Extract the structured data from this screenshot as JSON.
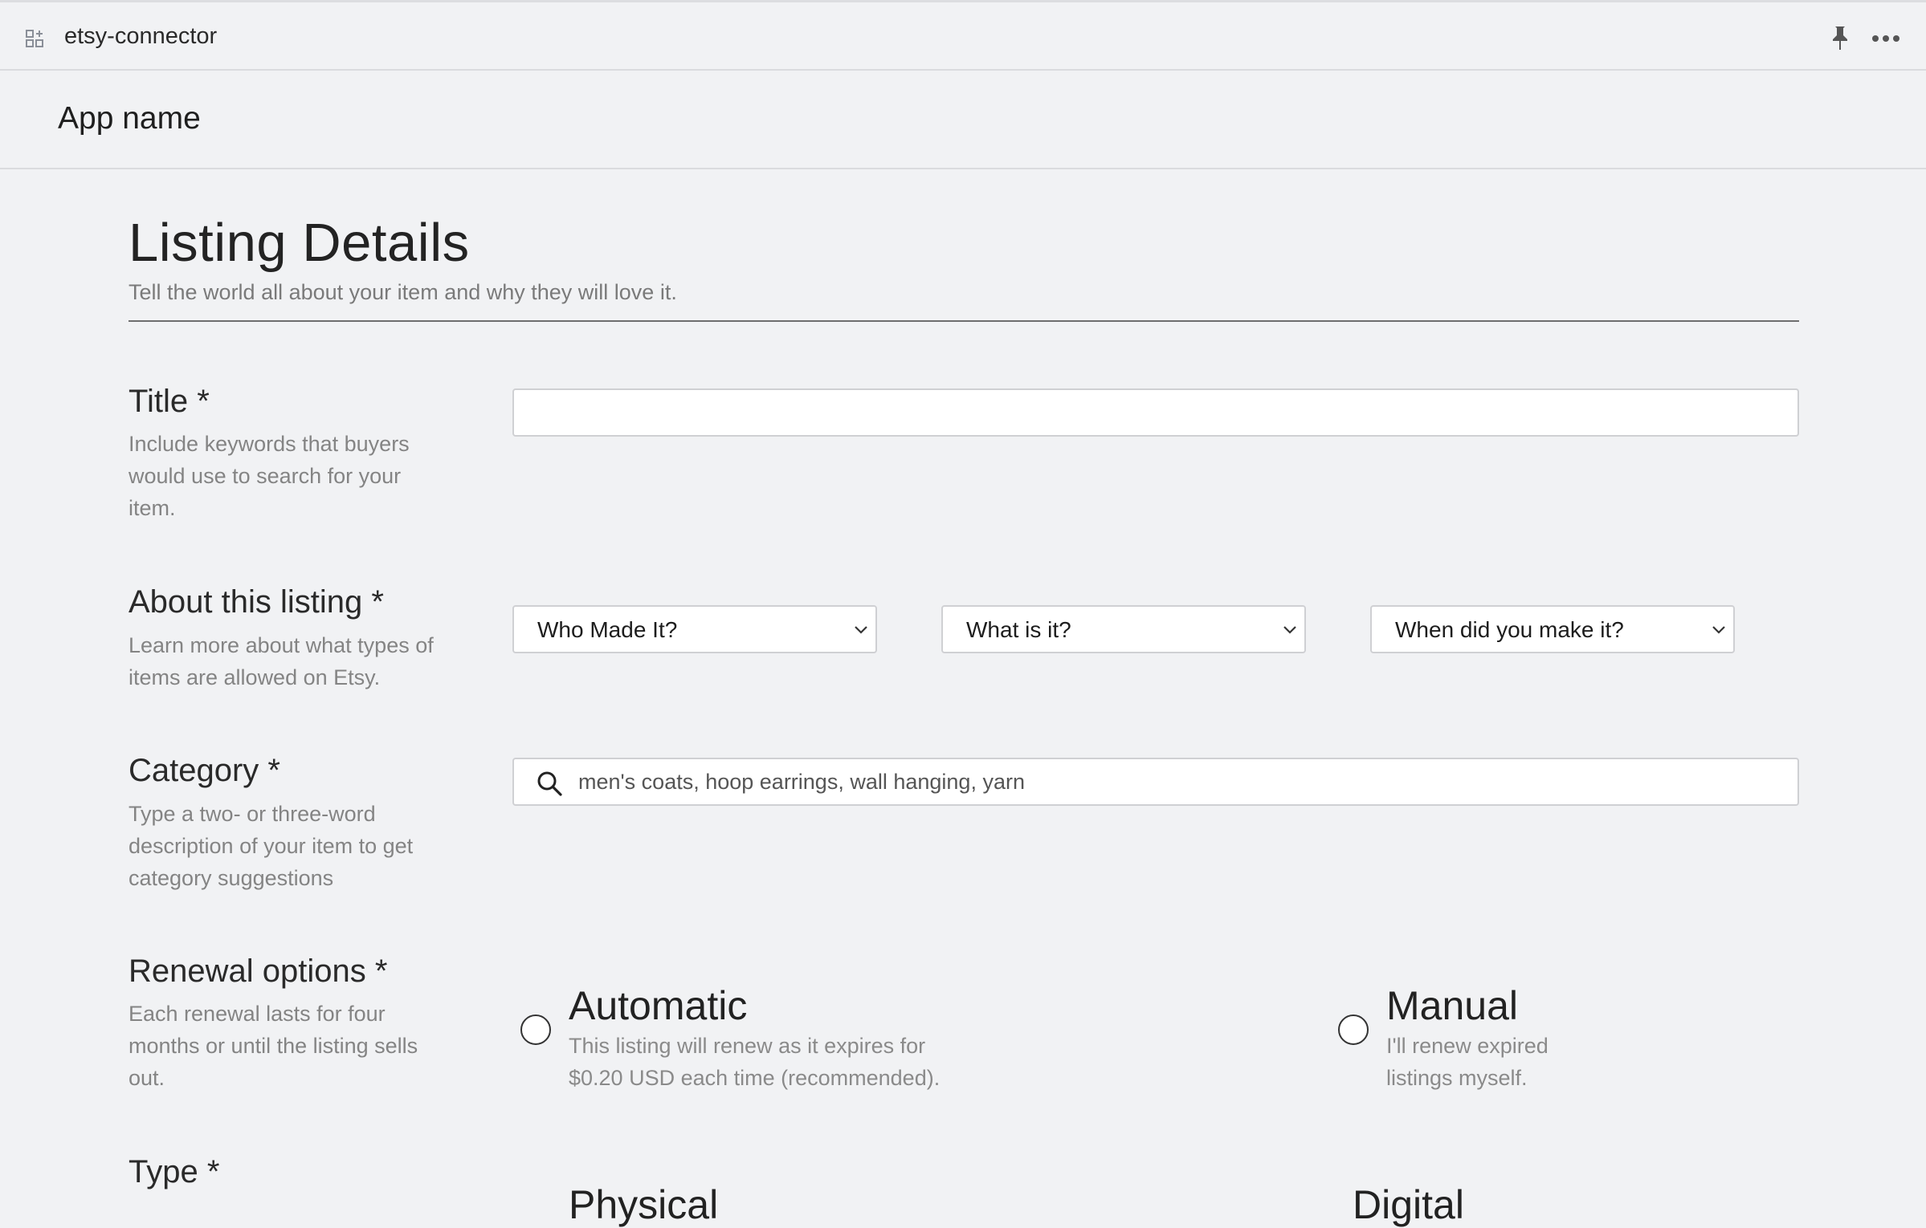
{
  "window": {
    "title": "etsy-connector",
    "icons": {
      "app": "grid-icon",
      "pin": "pin-icon",
      "more": "more-icon"
    }
  },
  "app": {
    "name": "App name"
  },
  "header": {
    "title": "Listing Details",
    "subtitle": "Tell the world all about your item and why they will love it."
  },
  "fields": {
    "title": {
      "label": "Title *",
      "description": "Include keywords that buyers would use to search for your item.",
      "value": ""
    },
    "about": {
      "label": "About this listing *",
      "description": "Learn more about what types of items are allowed on Etsy.",
      "selects": [
        "Who Made It?",
        "What is it?",
        "When did you make it?"
      ]
    },
    "category": {
      "label": "Category *",
      "description": "Type a two- or three-word description of your item to get category suggestions",
      "placeholder": "men's coats, hoop earrings, wall hanging, yarn"
    },
    "renewal": {
      "label": "Renewal options *",
      "description": "Each renewal lasts for four months or until the listing sells out.",
      "options": [
        {
          "title": "Automatic",
          "description": "This listing will renew as it expires for $0.20 USD each time (recommended)."
        },
        {
          "title": "Manual",
          "description": "I'll renew expired listings myself."
        }
      ]
    },
    "type": {
      "label": "Type *",
      "options": [
        {
          "title": "Physical"
        },
        {
          "title": "Digital"
        }
      ]
    }
  },
  "colors": {
    "background": "#f1f2f4",
    "border": "#cfd0d3",
    "rule": "#6e6e6e"
  }
}
